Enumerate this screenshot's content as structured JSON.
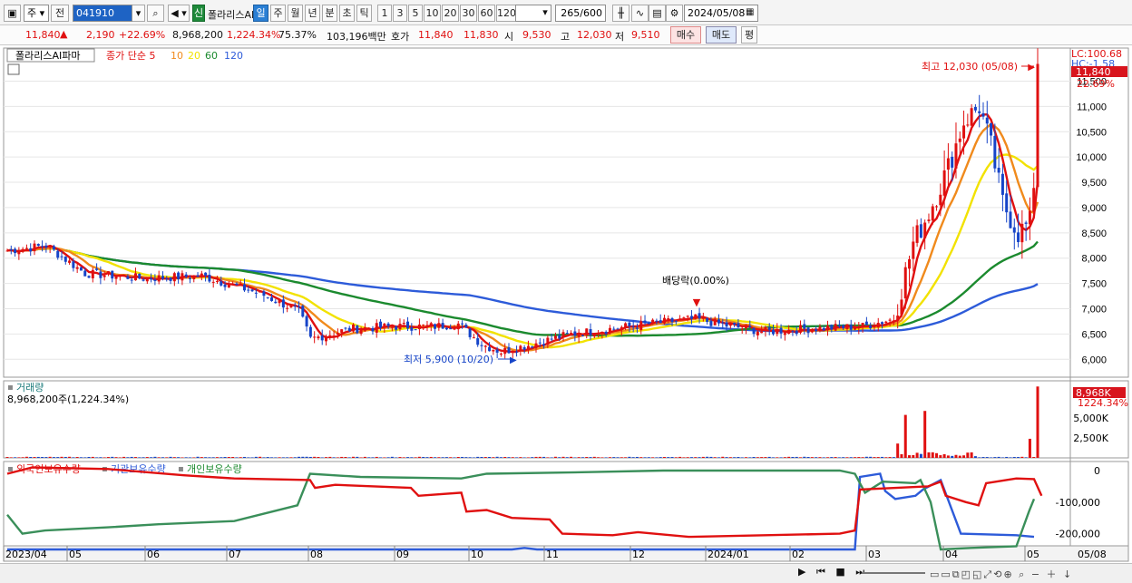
{
  "toolbar": {
    "market": "주",
    "prev_label": "전",
    "code": "041910",
    "new_badge": "신",
    "stock_name": "폴라리스AI",
    "periods": [
      "일",
      "주",
      "월",
      "년",
      "분",
      "초",
      "틱"
    ],
    "active_period": "일",
    "intervals": [
      "1",
      "3",
      "5",
      "10",
      "20",
      "30",
      "60",
      "120"
    ],
    "count": "265",
    "count_max": "/600",
    "date": "2024/05/08"
  },
  "quote": {
    "price": "11,840",
    "change": "2,190",
    "change_pct": "+22.69%",
    "volume": "8,968,200",
    "volume_pct": "1,224.34%",
    "turnover": "75.37%",
    "amount": "103,196백만",
    "hoga_label": "호가",
    "ask": "11,840",
    "bid": "11,830",
    "open_label": "시",
    "open": "9,530",
    "high_label": "고",
    "high": "12,030",
    "low_label": "저",
    "low": "9,510",
    "buy_label": "매수",
    "sell_label": "매도",
    "eval_label": "평"
  },
  "price_panel": {
    "title": "폴라리스AI파마",
    "ma_label": "종가 단순",
    "ma_periods": [
      "5",
      "10",
      "20",
      "60",
      "120"
    ],
    "ma_colors": [
      "#e01010",
      "#f08a1c",
      "#f2e200",
      "#1b8a2e",
      "#2d5bd9"
    ],
    "lc_label": "LC:100.68",
    "hc_label": "HC:-1.58",
    "current_price_tag": "11,840",
    "current_pct_tag": "22.69%",
    "y_ticks": [
      "11,500",
      "11,000",
      "10,500",
      "10,000",
      "9,500",
      "9,000",
      "8,500",
      "8,000",
      "7,500",
      "7,000",
      "6,500",
      "6,000"
    ],
    "high_annotation": "최고 12,030 (05/08)",
    "low_annotation": "최저 5,900 (10/20)",
    "dividend_annotation": "배당락(0.00%)"
  },
  "volume_panel": {
    "title": "거래량",
    "value": "8,968,200주(1,224.34%)",
    "tag_value": "8,968K",
    "tag_pct": "1224.34%",
    "y_ticks": [
      "5,000K",
      "2,500K"
    ]
  },
  "holding_panel": {
    "legend": [
      "외국인보유수량",
      "기관보유수량",
      "개인보유수량"
    ],
    "colors": [
      "#e01010",
      "#2d5bd9",
      "#1b8a2e"
    ],
    "y_ticks": [
      "0",
      "-100,000",
      "-200,000"
    ]
  },
  "x_axis": {
    "labels": [
      "2023/04",
      "05",
      "06",
      "07",
      "08",
      "09",
      "10",
      "11",
      "12",
      "2024/01",
      "02",
      "03",
      "04",
      "05"
    ],
    "last_label": "05/08"
  },
  "chart_data": {
    "type": "line",
    "title": "폴라리스AI파마",
    "series": [
      {
        "name": "종가",
        "x": [
          "2023/04",
          "05",
          "06",
          "07",
          "08",
          "09",
          "10",
          "11",
          "12",
          "2024/01",
          "02",
          "03",
          "04",
          "05"
        ],
        "values": [
          8200,
          7700,
          7650,
          7100,
          6650,
          6800,
          6100,
          6400,
          6600,
          6800,
          6600,
          8300,
          9500,
          11840
        ]
      }
    ],
    "ylim": [
      5700,
      12100
    ]
  }
}
